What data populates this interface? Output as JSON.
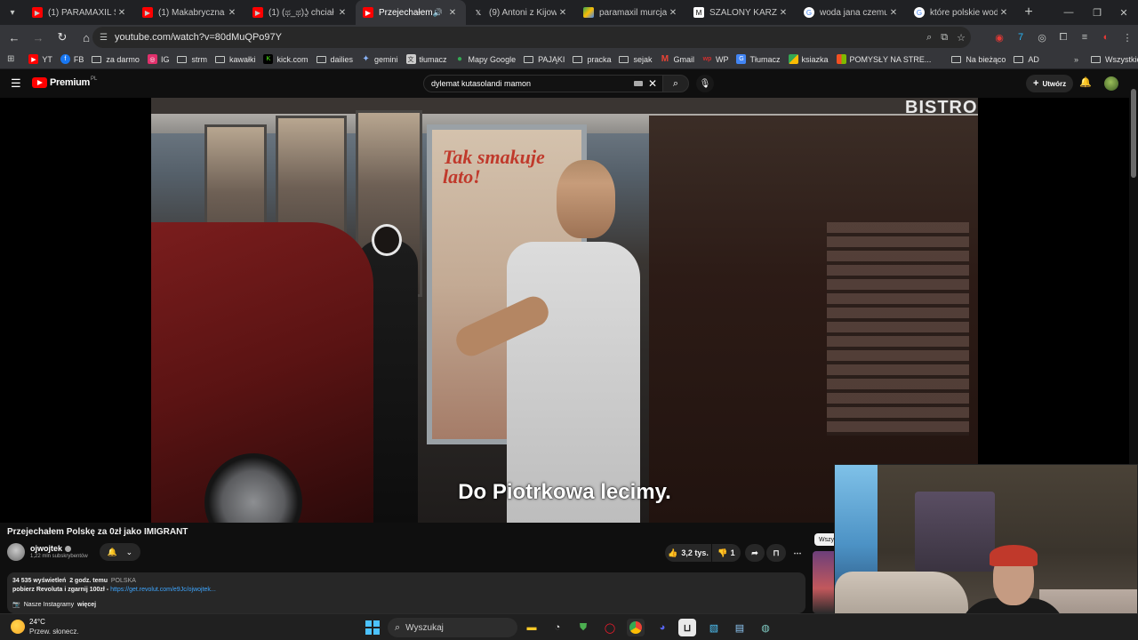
{
  "browser": {
    "tabs": [
      {
        "title": "(1) PARAMAXIL SZAL",
        "favicon_color": "#ff0000",
        "active": false
      },
      {
        "title": "(1) Makabryczna zbro",
        "favicon_color": "#ff0000",
        "active": false
      },
      {
        "title": "(1) (ಥ_ಥ)ʖ̯ chciał",
        "favicon_color": "#ff0000",
        "active": false
      },
      {
        "title": "Przejechałem Pol",
        "favicon_color": "#ff0000",
        "active": true
      },
      {
        "title": "(9) Antoni z Kijowa w",
        "favicon_color": "#000000",
        "active": false
      },
      {
        "title": "paramaxil murcja 80",
        "favicon_color": "#34a853",
        "active": false
      },
      {
        "title": "SZALONY KARZEŁ PO",
        "favicon_color": "#ffffff",
        "active": false
      },
      {
        "title": "woda jana czemu jes",
        "favicon_color": "#ffffff",
        "active": false
      },
      {
        "title": "które polskie wody s",
        "favicon_color": "#ffffff",
        "active": false
      }
    ],
    "url": "youtube.com/watch?v=80dMuQPo97Y",
    "bookmarks": [
      {
        "label": "YT",
        "icon": "youtube-icon",
        "color": "#ff0000"
      },
      {
        "label": "FB",
        "icon": "facebook-icon",
        "color": "#1877f2"
      },
      {
        "label": "za darmo",
        "icon": "folder-icon"
      },
      {
        "label": "IG",
        "icon": "instagram-icon",
        "color": "#e1306c"
      },
      {
        "label": "strm",
        "icon": "folder-icon"
      },
      {
        "label": "kawałki",
        "icon": "folder-icon"
      },
      {
        "label": "kick.com",
        "icon": "kick-icon",
        "color": "#53fc18"
      },
      {
        "label": "dailies",
        "icon": "folder-icon"
      },
      {
        "label": "gemini",
        "icon": "gemini-icon",
        "color": "#8ab4f8"
      },
      {
        "label": "tłumacz",
        "icon": "translate-icon",
        "color": "#cccccc"
      },
      {
        "label": "Mapy Google",
        "icon": "maps-icon",
        "color": "#34a853"
      },
      {
        "label": "PAJĄKI",
        "icon": "folder-icon"
      },
      {
        "label": "pracka",
        "icon": "folder-icon"
      },
      {
        "label": "sejak",
        "icon": "folder-icon"
      },
      {
        "label": "Gmail",
        "icon": "gmail-icon",
        "color": "#ea4335"
      },
      {
        "label": "WP",
        "icon": "wp-icon",
        "color": "#d32f2f"
      },
      {
        "label": "Tłumacz",
        "icon": "translate-icon",
        "color": "#4285f4"
      },
      {
        "label": "ksiazka",
        "icon": "book-icon",
        "color": "#fbbc04"
      },
      {
        "label": "POMYSŁY NA STRE...",
        "icon": "windows-icon",
        "color": "#f25022"
      },
      {
        "label": "Na bieżąco",
        "icon": "folder-icon"
      },
      {
        "label": "AD",
        "icon": "folder-icon"
      }
    ],
    "all_bookmarks_label": "Wszystkie zakładki"
  },
  "youtube": {
    "brand": "Premium",
    "region": "PL",
    "search_query": "dylemat kutasolandi mamon",
    "create_label": "Utwórz",
    "video": {
      "subtitle": "Do Piotrkowa lecimy.",
      "sign_text": "BISTRO",
      "promo_text": "Tak smakuje lato!"
    },
    "title": "Przejechałem Polskę za 0zł jako IMIGRANT",
    "channel": {
      "name": "ojwojtek",
      "subscribers": "1,22 mln subskrybentów"
    },
    "likes": "3,2 tys.",
    "dislikes": "1",
    "description": {
      "views": "34 535 wyświetleń",
      "time": "2 godz. temu",
      "tag": "POLSKA",
      "promo_text": "pobierz Revoluta i zgarnij 100zł - ",
      "promo_link": "https://get.revolut.com/e9Jc/ojwojtek...",
      "instagram_label": "Nasze Instagramy",
      "more_label": "więcej"
    },
    "chip_label": "Wszy"
  },
  "taskbar": {
    "temperature": "24°C",
    "weather": "Przew. słonecz.",
    "search_placeholder": "Wyszukaj"
  },
  "colors": {
    "youtube_red": "#ff0000",
    "background": "#0f0f0f",
    "link": "#3ea6ff",
    "chrome_dark": "#202124"
  }
}
